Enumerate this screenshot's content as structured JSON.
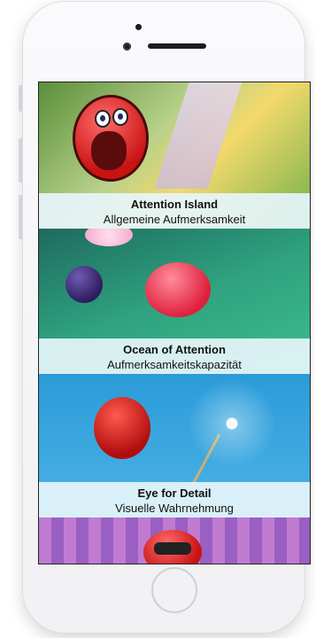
{
  "games": [
    {
      "title": "Attention Island",
      "subtitle": "Allgemeine Aufmerksamkeit"
    },
    {
      "title": "Ocean of Attention",
      "subtitle": "Aufmerksamkeitskapazität"
    },
    {
      "title": "Eye for Detail",
      "subtitle": "Visuelle Wahrnehmung"
    }
  ],
  "icons": {
    "camera": "camera-icon",
    "home": "home-button-icon"
  }
}
